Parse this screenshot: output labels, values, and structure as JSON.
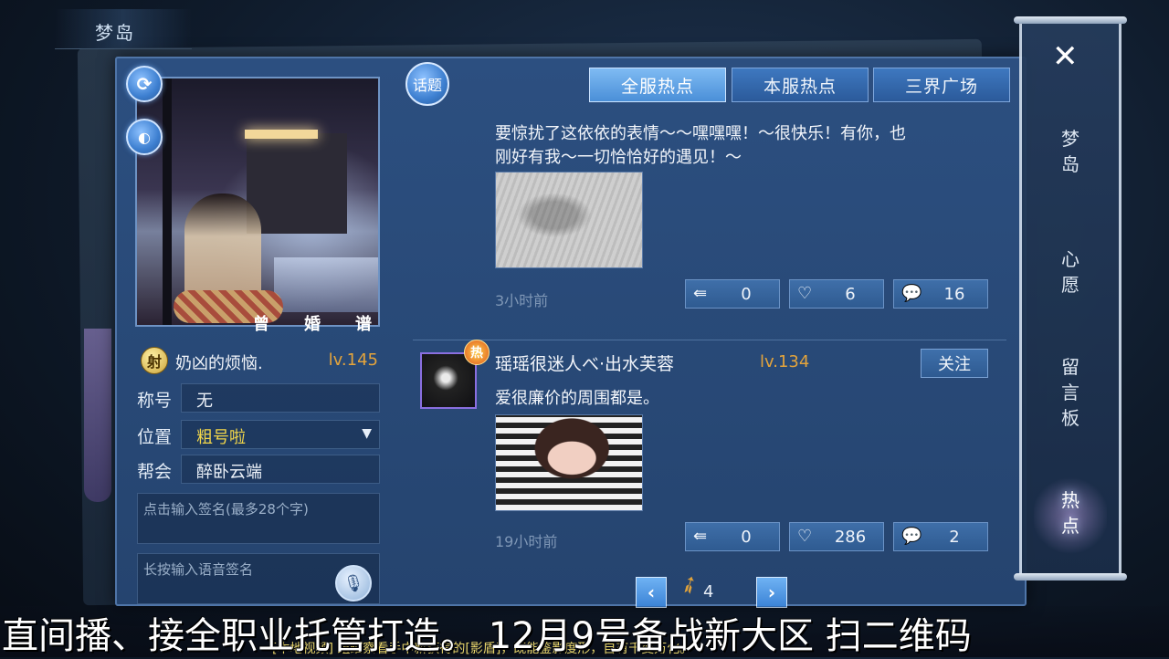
{
  "window": {
    "title": "梦岛"
  },
  "profile": {
    "badge": "射",
    "name": "奶凶的烦恼.",
    "level": "lv.145",
    "relation_buttons": [
      "曾",
      "婚",
      "谱"
    ],
    "fields": {
      "title_label": "称号",
      "title_value": "无",
      "location_label": "位置",
      "location_value": "粗号啦",
      "guild_label": "帮会",
      "guild_value": "醉卧云端"
    },
    "signature_placeholder": "点击输入签名(最多28个字)",
    "voice_signature_placeholder": "长按输入语音签名"
  },
  "feed": {
    "topic_button": "话题",
    "tabs": [
      "全服热点",
      "本服热点",
      "三界广场"
    ],
    "active_tab": 0,
    "posts": [
      {
        "text_lines": [
          "要惊扰了这依依的表情～～嘿嘿嘿！～很快乐！有你，也",
          "刚好有我～一切恰恰好的遇见！～"
        ],
        "time": "3小时前",
        "shares": "0",
        "likes": "6",
        "comments": "16"
      },
      {
        "hot_badge": "热",
        "author": "瑶瑶很迷人べ·出水芙蓉",
        "level": "lv.134",
        "follow_label": "关注",
        "text": "爱很廉价的周围都是。",
        "time": "19小时前",
        "shares": "0",
        "likes": "286",
        "comments": "2"
      }
    ],
    "page": "4"
  },
  "side_nav": {
    "close": "✕",
    "items": [
      "梦岛",
      "心愿",
      "留言板",
      "热点"
    ],
    "active": 3
  },
  "overlay": {
    "banner": "直间播、接全职业托管打造。 12月9号备战新大区 扫二维码",
    "system_message": "[本地视频] 组细察看手中新获得的[影盾]，既能鉴影度形，自有千变万化。"
  },
  "icons": {
    "refresh": "refresh-icon",
    "mask": "mask-icon",
    "mic": "microphone-icon",
    "share": "share-icon",
    "like": "heart-icon",
    "comment": "comment-icon"
  }
}
